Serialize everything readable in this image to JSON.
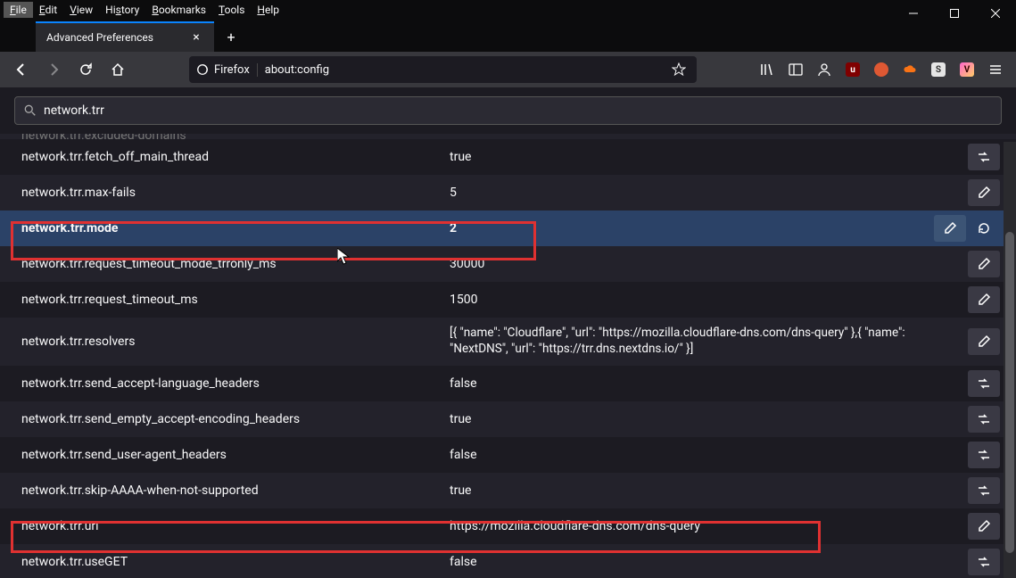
{
  "menubar": {
    "items": [
      {
        "label": "File",
        "key": "F"
      },
      {
        "label": "Edit",
        "key": "E"
      },
      {
        "label": "View",
        "key": "V"
      },
      {
        "label": "History",
        "key": "s"
      },
      {
        "label": "Bookmarks",
        "key": "B"
      },
      {
        "label": "Tools",
        "key": "T"
      },
      {
        "label": "Help",
        "key": "H"
      }
    ]
  },
  "tab": {
    "title": "Advanced Preferences"
  },
  "urlbar": {
    "identity": "Firefox",
    "url": "about:config"
  },
  "search": {
    "text": "network.trr"
  },
  "truncated": {
    "label": "network.trr.excluded-domains"
  },
  "prefs": [
    {
      "name": "network.trr.fetch_off_main_thread",
      "value": "true",
      "action": "toggle",
      "parity": "even"
    },
    {
      "name": "network.trr.max-fails",
      "value": "5",
      "action": "edit",
      "parity": "odd"
    },
    {
      "name": "network.trr.mode",
      "value": "2",
      "action": "edit",
      "parity": "even",
      "selected": true,
      "reset": true
    },
    {
      "name": "network.trr.request_timeout_mode_trronly_ms",
      "value": "30000",
      "action": "edit",
      "parity": "odd"
    },
    {
      "name": "network.trr.request_timeout_ms",
      "value": "1500",
      "action": "edit",
      "parity": "even"
    },
    {
      "name": "network.trr.resolvers",
      "value": "[{ \"name\": \"Cloudflare\", \"url\": \"https://mozilla.cloudflare-dns.com/dns-query\" },{ \"name\": \"NextDNS\", \"url\": \"https://trr.dns.nextdns.io/\" }]",
      "action": "edit",
      "parity": "odd",
      "tall": true
    },
    {
      "name": "network.trr.send_accept-language_headers",
      "value": "false",
      "action": "toggle",
      "parity": "even"
    },
    {
      "name": "network.trr.send_empty_accept-encoding_headers",
      "value": "true",
      "action": "toggle",
      "parity": "odd"
    },
    {
      "name": "network.trr.send_user-agent_headers",
      "value": "false",
      "action": "toggle",
      "parity": "even"
    },
    {
      "name": "network.trr.skip-AAAA-when-not-supported",
      "value": "true",
      "action": "toggle",
      "parity": "odd"
    },
    {
      "name": "network.trr.uri",
      "value": "https://mozilla.cloudflare-dns.com/dns-query",
      "action": "edit",
      "parity": "even"
    },
    {
      "name": "network.trr.useGET",
      "value": "false",
      "action": "toggle",
      "parity": "odd"
    }
  ],
  "colors": {
    "highlight": "#e03131",
    "accent": "#0a84ff"
  }
}
